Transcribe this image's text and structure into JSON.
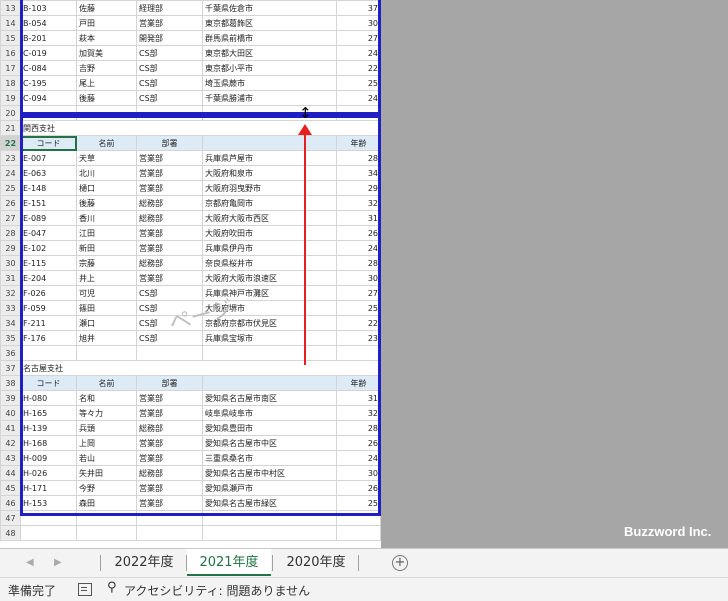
{
  "sheet": {
    "rows": [
      {
        "n": "13",
        "code": "B-103",
        "name": "佐藤",
        "dept": "経理部",
        "addr": "千葉県佐倉市",
        "age": "37",
        "type": "data"
      },
      {
        "n": "14",
        "code": "B-054",
        "name": "戸田",
        "dept": "営業部",
        "addr": "東京都葛飾区",
        "age": "30",
        "type": "data"
      },
      {
        "n": "15",
        "code": "B-201",
        "name": "萩本",
        "dept": "開発部",
        "addr": "群馬県前橋市",
        "age": "27",
        "type": "data"
      },
      {
        "n": "16",
        "code": "C-019",
        "name": "加賀美",
        "dept": "CS部",
        "addr": "東京都大田区",
        "age": "24",
        "type": "data"
      },
      {
        "n": "17",
        "code": "C-084",
        "name": "吉野",
        "dept": "CS部",
        "addr": "東京都小平市",
        "age": "22",
        "type": "data"
      },
      {
        "n": "18",
        "code": "C-195",
        "name": "尾上",
        "dept": "CS部",
        "addr": "埼玉県蕨市",
        "age": "25",
        "type": "data"
      },
      {
        "n": "19",
        "code": "C-094",
        "name": "後藤",
        "dept": "CS部",
        "addr": "千葉県勝浦市",
        "age": "24",
        "type": "data"
      },
      {
        "n": "20",
        "type": "empty"
      },
      {
        "n": "21",
        "type": "title",
        "title": "関西支社"
      },
      {
        "n": "22",
        "type": "header",
        "code": "コード",
        "name": "名前",
        "dept": "部署",
        "addr": "",
        "age": "年齢"
      },
      {
        "n": "23",
        "code": "E-007",
        "name": "天草",
        "dept": "営業部",
        "addr": "兵庫県芦屋市",
        "age": "28",
        "type": "data"
      },
      {
        "n": "24",
        "code": "E-063",
        "name": "北川",
        "dept": "営業部",
        "addr": "大阪府和泉市",
        "age": "34",
        "type": "data"
      },
      {
        "n": "25",
        "code": "E-148",
        "name": "樋口",
        "dept": "営業部",
        "addr": "大阪府羽曳野市",
        "age": "29",
        "type": "data"
      },
      {
        "n": "26",
        "code": "E-151",
        "name": "後藤",
        "dept": "総務部",
        "addr": "京都府亀岡市",
        "age": "32",
        "type": "data"
      },
      {
        "n": "27",
        "code": "E-089",
        "name": "香川",
        "dept": "総務部",
        "addr": "大阪府大阪市西区",
        "age": "31",
        "type": "data"
      },
      {
        "n": "28",
        "code": "E-047",
        "name": "江田",
        "dept": "営業部",
        "addr": "大阪府吹田市",
        "age": "26",
        "type": "data"
      },
      {
        "n": "29",
        "code": "E-102",
        "name": "新田",
        "dept": "営業部",
        "addr": "兵庫県伊丹市",
        "age": "24",
        "type": "data"
      },
      {
        "n": "30",
        "code": "E-115",
        "name": "宗藤",
        "dept": "総務部",
        "addr": "奈良県桜井市",
        "age": "28",
        "type": "data"
      },
      {
        "n": "31",
        "code": "E-204",
        "name": "井上",
        "dept": "営業部",
        "addr": "大阪府大阪市浪速区",
        "age": "30",
        "type": "data"
      },
      {
        "n": "32",
        "code": "F-026",
        "name": "可児",
        "dept": "CS部",
        "addr": "兵庫県神戸市灘区",
        "age": "27",
        "type": "data"
      },
      {
        "n": "33",
        "code": "F-059",
        "name": "篠田",
        "dept": "CS部",
        "addr": "大阪府堺市",
        "age": "25",
        "type": "data"
      },
      {
        "n": "34",
        "code": "F-211",
        "name": "瀬口",
        "dept": "CS部",
        "addr": "京都府京都市伏見区",
        "age": "22",
        "type": "data"
      },
      {
        "n": "35",
        "code": "F-176",
        "name": "旭井",
        "dept": "CS部",
        "addr": "兵庫県宝塚市",
        "age": "23",
        "type": "data"
      },
      {
        "n": "36",
        "type": "empty"
      },
      {
        "n": "37",
        "type": "title",
        "title": "名古屋支社"
      },
      {
        "n": "38",
        "type": "header",
        "code": "コード",
        "name": "名前",
        "dept": "部署",
        "addr": "",
        "age": "年齢"
      },
      {
        "n": "39",
        "code": "H-080",
        "name": "名和",
        "dept": "営業部",
        "addr": "愛知県名古屋市南区",
        "age": "31",
        "type": "data"
      },
      {
        "n": "40",
        "code": "H-165",
        "name": "等々力",
        "dept": "営業部",
        "addr": "岐阜県岐阜市",
        "age": "32",
        "type": "data"
      },
      {
        "n": "41",
        "code": "H-139",
        "name": "兵頭",
        "dept": "総務部",
        "addr": "愛知県豊田市",
        "age": "28",
        "type": "data"
      },
      {
        "n": "42",
        "code": "H-168",
        "name": "上岡",
        "dept": "営業部",
        "addr": "愛知県名古屋市中区",
        "age": "26",
        "type": "data"
      },
      {
        "n": "43",
        "code": "H-009",
        "name": "若山",
        "dept": "営業部",
        "addr": "三重県桑名市",
        "age": "24",
        "type": "data"
      },
      {
        "n": "44",
        "code": "H-026",
        "name": "矢井田",
        "dept": "総務部",
        "addr": "愛知県名古屋市中村区",
        "age": "30",
        "type": "data"
      },
      {
        "n": "45",
        "code": "H-171",
        "name": "今野",
        "dept": "営業部",
        "addr": "愛知県瀬戸市",
        "age": "26",
        "type": "data"
      },
      {
        "n": "46",
        "code": "H-153",
        "name": "森田",
        "dept": "営業部",
        "addr": "愛知県名古屋市緑区",
        "age": "25",
        "type": "data"
      },
      {
        "n": "47",
        "type": "empty"
      },
      {
        "n": "48",
        "type": "empty"
      }
    ],
    "page_watermark": "ページ"
  },
  "tabs": [
    {
      "label": "2022年度",
      "active": false
    },
    {
      "label": "2021年度",
      "active": true
    },
    {
      "label": "2020年度",
      "active": false
    }
  ],
  "add_sheet_symbol": "+",
  "status": {
    "ready": "準備完了",
    "accessibility": "アクセシビリティ: 問題ありません"
  },
  "watermark": "Buzzword Inc.",
  "colors": {
    "page_break": "#1f1fc4",
    "arrow": "#e62020",
    "accent": "#217346"
  }
}
